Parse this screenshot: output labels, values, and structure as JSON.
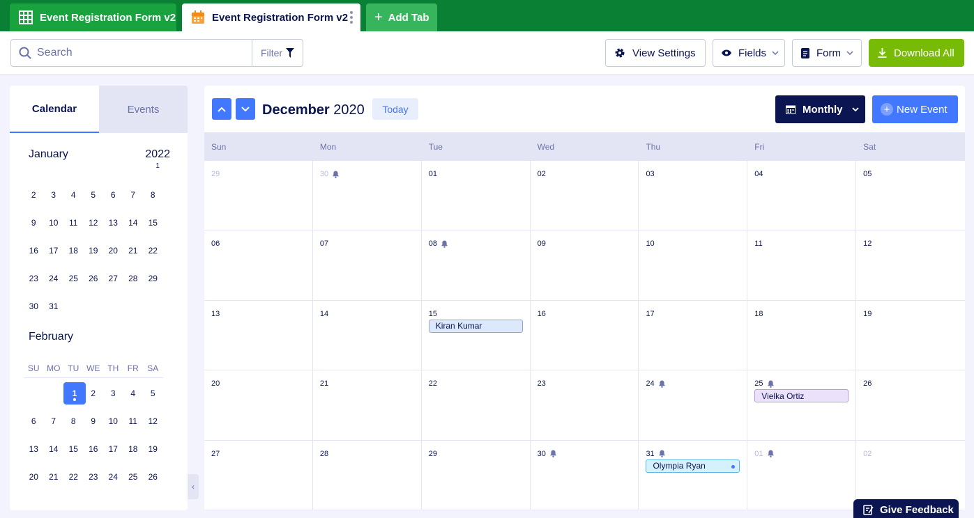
{
  "tabs": [
    {
      "label": "Event Registration Form v2",
      "icon": "table-icon"
    },
    {
      "label": "Event Registration Form v2",
      "icon": "calendar-icon"
    },
    {
      "label": "Add Tab",
      "icon": "plus-icon"
    }
  ],
  "toolbar": {
    "search_placeholder": "Search",
    "filter_label": "Filter",
    "view_settings": "View Settings",
    "fields": "Fields",
    "form": "Form",
    "download_all": "Download All"
  },
  "sidebar": {
    "tab_calendar": "Calendar",
    "tab_events": "Events",
    "year": "2022",
    "year_sub": "1",
    "month1": "January",
    "month1_weeks": [
      [
        "2",
        "3",
        "4",
        "5",
        "6",
        "7",
        "8"
      ],
      [
        "9",
        "10",
        "11",
        "12",
        "13",
        "14",
        "15"
      ],
      [
        "16",
        "17",
        "18",
        "19",
        "20",
        "21",
        "22"
      ],
      [
        "23",
        "24",
        "25",
        "26",
        "27",
        "28",
        "29"
      ],
      [
        "30",
        "31",
        "",
        "",
        "",
        "",
        ""
      ]
    ],
    "month2": "February",
    "dow": [
      "SU",
      "MO",
      "TU",
      "WE",
      "TH",
      "FR",
      "SA"
    ],
    "month2_weeks": [
      [
        "",
        "",
        "1",
        "2",
        "3",
        "4",
        "5"
      ],
      [
        "6",
        "7",
        "8",
        "9",
        "10",
        "11",
        "12"
      ],
      [
        "13",
        "14",
        "15",
        "16",
        "17",
        "18",
        "19"
      ],
      [
        "20",
        "21",
        "22",
        "23",
        "24",
        "25",
        "26"
      ]
    ],
    "selected_day": "1"
  },
  "calendar": {
    "month": "December",
    "year": "2020",
    "today": "Today",
    "view": "Monthly",
    "new_event": "New Event",
    "weekdays": [
      "Sun",
      "Mon",
      "Tue",
      "Wed",
      "Thu",
      "Fri",
      "Sat"
    ],
    "weeks": [
      [
        {
          "d": "29",
          "o": true
        },
        {
          "d": "30",
          "o": true,
          "b": true
        },
        {
          "d": "01"
        },
        {
          "d": "02"
        },
        {
          "d": "03"
        },
        {
          "d": "04"
        },
        {
          "d": "05"
        }
      ],
      [
        {
          "d": "06"
        },
        {
          "d": "07"
        },
        {
          "d": "08",
          "b": true
        },
        {
          "d": "09"
        },
        {
          "d": "10"
        },
        {
          "d": "11"
        },
        {
          "d": "12"
        }
      ],
      [
        {
          "d": "13"
        },
        {
          "d": "14"
        },
        {
          "d": "15",
          "e": "Kiran Kumar",
          "c": "blue"
        },
        {
          "d": "16"
        },
        {
          "d": "17"
        },
        {
          "d": "18"
        },
        {
          "d": "19"
        }
      ],
      [
        {
          "d": "20"
        },
        {
          "d": "21"
        },
        {
          "d": "22"
        },
        {
          "d": "23"
        },
        {
          "d": "24",
          "b": true
        },
        {
          "d": "25",
          "b": true,
          "e": "Vielka Ortiz",
          "c": "purple"
        },
        {
          "d": "26"
        }
      ],
      [
        {
          "d": "27"
        },
        {
          "d": "28"
        },
        {
          "d": "29"
        },
        {
          "d": "30",
          "b": true
        },
        {
          "d": "31",
          "b": true,
          "e": "Olympia Ryan",
          "c": "cyan"
        },
        {
          "d": "01",
          "o": true,
          "b": true
        },
        {
          "d": "02",
          "o": true
        }
      ]
    ]
  },
  "feedback": "Give Feedback",
  "colors": {
    "brand_green": "#0a8034",
    "accent_blue": "#4277ff",
    "navy": "#0a1551",
    "download_green": "#78bb07"
  }
}
